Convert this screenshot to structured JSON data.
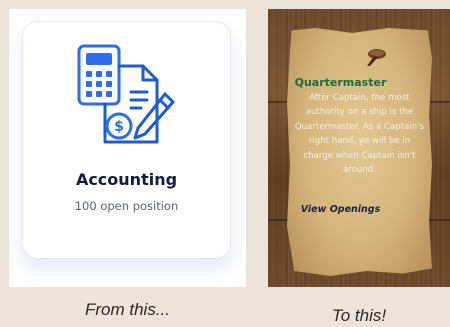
{
  "left_card": {
    "title": "Accounting",
    "subtitle": "100 open position",
    "icon": "accounting-icon",
    "accent_color": "#2d6ee6"
  },
  "right_card": {
    "title": "Quartermaster",
    "body": "After Captain, the most authority on a ship is the Quartermaster. As a Captain's right hand, ye will be in charge when Captain isn't around.",
    "link_label": "View Openings",
    "title_color": "#1e6b3a"
  },
  "captions": {
    "left": "From this...",
    "right": "To this!"
  }
}
